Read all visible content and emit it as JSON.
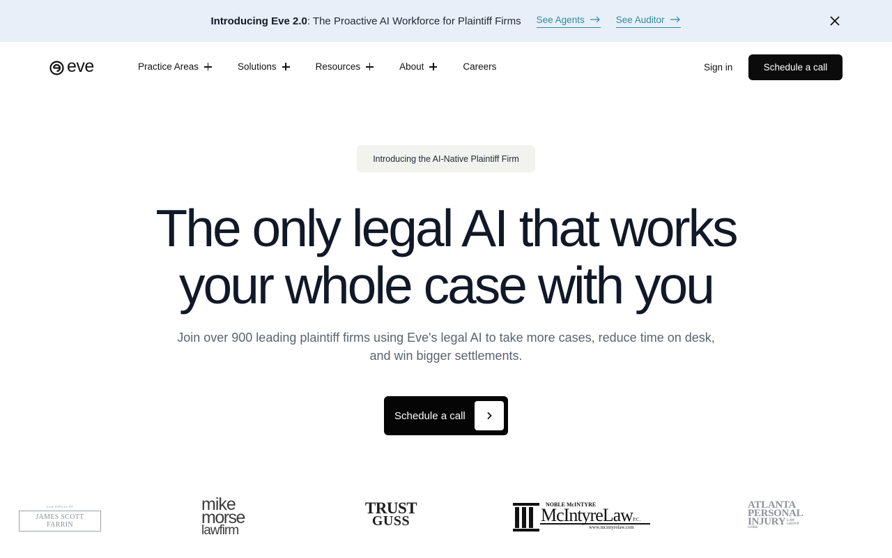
{
  "announcement": {
    "title_bold": "Introducing Eve 2.0",
    "title_rest": ": The Proactive AI Workforce for Plaintiff Firms",
    "link_agents": "See Agents",
    "link_auditor": "See Auditor",
    "close_icon": "close-icon"
  },
  "nav": {
    "logo_text": "eve",
    "items": [
      {
        "label": "Practice Areas",
        "expandable": true
      },
      {
        "label": "Solutions",
        "expandable": true
      },
      {
        "label": "Resources",
        "expandable": true
      },
      {
        "label": "About",
        "expandable": true
      },
      {
        "label": "Careers",
        "expandable": false
      }
    ],
    "sign_in": "Sign in",
    "cta": "Schedule a call"
  },
  "hero": {
    "pill": "Introducing the AI-Native Plaintiff Firm",
    "headline_line1": "The only legal AI that works",
    "headline_line2": "your whole case with you",
    "subtext": "Join over 900 leading plaintiff firms using Eve's legal AI to take more cases, reduce time on desk, and win bigger settlements.",
    "cta": "Schedule a call",
    "cta_icon": "chevron-right-icon"
  },
  "logos": {
    "farrin_small": "Law Offices Of",
    "farrin_main": "JAMES SCOTT FARRIN",
    "morse_1": "mike",
    "morse_2": "morse",
    "morse_3": "lawfirm",
    "trust_1": "TRUST",
    "trust_2": "GUSS",
    "mcintyre_top": "NOBLE McINTYRE",
    "mcintyre_main": "McIntyreLaw",
    "mcintyre_pc": "P.C.",
    "mcintyre_url": "www.mcintyrelaw.com",
    "atl_1": "ATLANTA",
    "atl_2": "PERSONAL",
    "atl_3": "INJURY",
    "atl_gore": "GORE",
    "atl_lg1": "LAW",
    "atl_lg2": "GROUP"
  },
  "colors": {
    "announcement_bg": "#e9eff8",
    "link_teal": "#2e8a9c",
    "button_black": "#0b0b0b",
    "pill_bg": "#f2f2ee"
  }
}
